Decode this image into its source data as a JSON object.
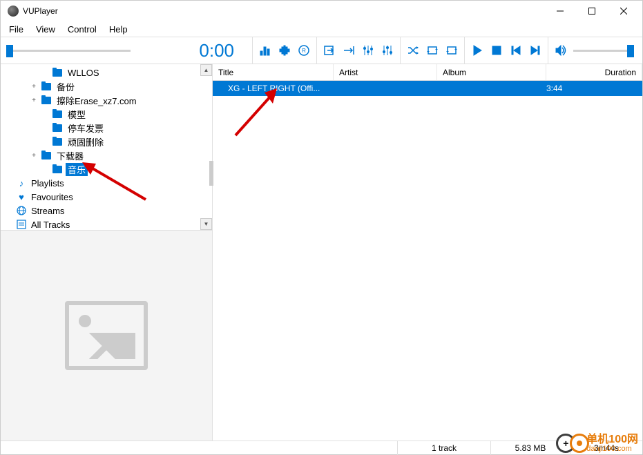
{
  "window": {
    "title": "VUPlayer"
  },
  "menu": {
    "file": "File",
    "view": "View",
    "control": "Control",
    "help": "Help"
  },
  "toolbar": {
    "time": "0:00"
  },
  "tree": {
    "items": [
      {
        "label": "WLLOS",
        "indent": 2,
        "exp": ""
      },
      {
        "label": "备份",
        "indent": 2,
        "exp": "+"
      },
      {
        "label": "擦除Erase_xz7.com",
        "indent": 2,
        "exp": "+"
      },
      {
        "label": "模型",
        "indent": 2,
        "exp": ""
      },
      {
        "label": "停车发票",
        "indent": 2,
        "exp": ""
      },
      {
        "label": "顽固删除",
        "indent": 2,
        "exp": ""
      },
      {
        "label": "下载器",
        "indent": 2,
        "exp": "+"
      },
      {
        "label": "音乐",
        "indent": 2,
        "exp": "",
        "selected": true
      }
    ],
    "library": {
      "playlists": "Playlists",
      "favourites": "Favourites",
      "streams": "Streams",
      "all_tracks": "All Tracks"
    }
  },
  "list": {
    "headers": {
      "title": "Title",
      "artist": "Artist",
      "album": "Album",
      "duration": "Duration"
    },
    "rows": [
      {
        "title": "XG - LEFT RIGHT (Offi...",
        "artist": "",
        "album": "",
        "duration": "3:44"
      }
    ]
  },
  "status": {
    "tracks": "1 track",
    "size": "5.83 MB",
    "duration": "3m44s"
  },
  "watermark": {
    "cn": "单机100网",
    "url": "danji100.com"
  }
}
